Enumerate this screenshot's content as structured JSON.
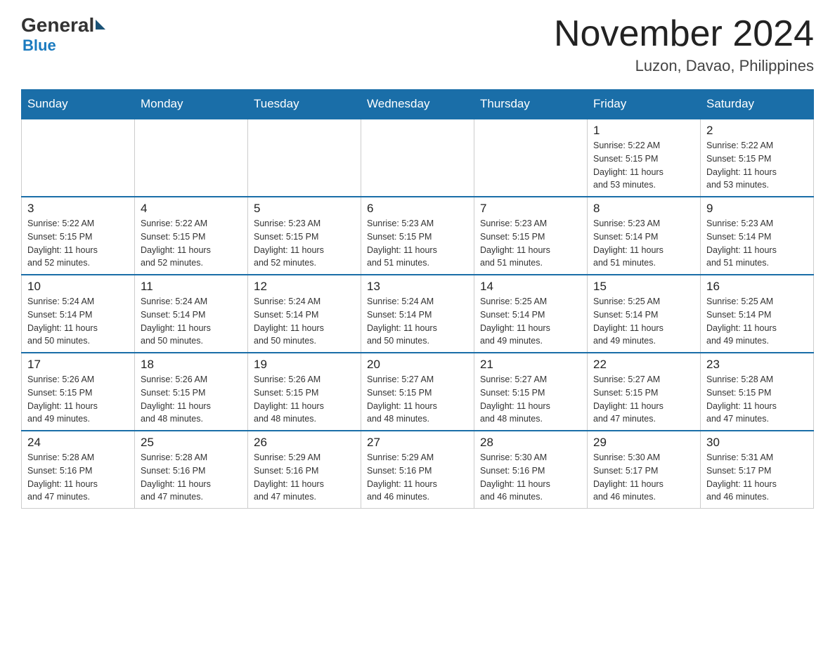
{
  "logo": {
    "general": "General",
    "blue": "Blue"
  },
  "header": {
    "month_year": "November 2024",
    "location": "Luzon, Davao, Philippines"
  },
  "weekdays": [
    "Sunday",
    "Monday",
    "Tuesday",
    "Wednesday",
    "Thursday",
    "Friday",
    "Saturday"
  ],
  "weeks": [
    [
      {
        "day": "",
        "info": ""
      },
      {
        "day": "",
        "info": ""
      },
      {
        "day": "",
        "info": ""
      },
      {
        "day": "",
        "info": ""
      },
      {
        "day": "",
        "info": ""
      },
      {
        "day": "1",
        "info": "Sunrise: 5:22 AM\nSunset: 5:15 PM\nDaylight: 11 hours\nand 53 minutes."
      },
      {
        "day": "2",
        "info": "Sunrise: 5:22 AM\nSunset: 5:15 PM\nDaylight: 11 hours\nand 53 minutes."
      }
    ],
    [
      {
        "day": "3",
        "info": "Sunrise: 5:22 AM\nSunset: 5:15 PM\nDaylight: 11 hours\nand 52 minutes."
      },
      {
        "day": "4",
        "info": "Sunrise: 5:22 AM\nSunset: 5:15 PM\nDaylight: 11 hours\nand 52 minutes."
      },
      {
        "day": "5",
        "info": "Sunrise: 5:23 AM\nSunset: 5:15 PM\nDaylight: 11 hours\nand 52 minutes."
      },
      {
        "day": "6",
        "info": "Sunrise: 5:23 AM\nSunset: 5:15 PM\nDaylight: 11 hours\nand 51 minutes."
      },
      {
        "day": "7",
        "info": "Sunrise: 5:23 AM\nSunset: 5:15 PM\nDaylight: 11 hours\nand 51 minutes."
      },
      {
        "day": "8",
        "info": "Sunrise: 5:23 AM\nSunset: 5:14 PM\nDaylight: 11 hours\nand 51 minutes."
      },
      {
        "day": "9",
        "info": "Sunrise: 5:23 AM\nSunset: 5:14 PM\nDaylight: 11 hours\nand 51 minutes."
      }
    ],
    [
      {
        "day": "10",
        "info": "Sunrise: 5:24 AM\nSunset: 5:14 PM\nDaylight: 11 hours\nand 50 minutes."
      },
      {
        "day": "11",
        "info": "Sunrise: 5:24 AM\nSunset: 5:14 PM\nDaylight: 11 hours\nand 50 minutes."
      },
      {
        "day": "12",
        "info": "Sunrise: 5:24 AM\nSunset: 5:14 PM\nDaylight: 11 hours\nand 50 minutes."
      },
      {
        "day": "13",
        "info": "Sunrise: 5:24 AM\nSunset: 5:14 PM\nDaylight: 11 hours\nand 50 minutes."
      },
      {
        "day": "14",
        "info": "Sunrise: 5:25 AM\nSunset: 5:14 PM\nDaylight: 11 hours\nand 49 minutes."
      },
      {
        "day": "15",
        "info": "Sunrise: 5:25 AM\nSunset: 5:14 PM\nDaylight: 11 hours\nand 49 minutes."
      },
      {
        "day": "16",
        "info": "Sunrise: 5:25 AM\nSunset: 5:14 PM\nDaylight: 11 hours\nand 49 minutes."
      }
    ],
    [
      {
        "day": "17",
        "info": "Sunrise: 5:26 AM\nSunset: 5:15 PM\nDaylight: 11 hours\nand 49 minutes."
      },
      {
        "day": "18",
        "info": "Sunrise: 5:26 AM\nSunset: 5:15 PM\nDaylight: 11 hours\nand 48 minutes."
      },
      {
        "day": "19",
        "info": "Sunrise: 5:26 AM\nSunset: 5:15 PM\nDaylight: 11 hours\nand 48 minutes."
      },
      {
        "day": "20",
        "info": "Sunrise: 5:27 AM\nSunset: 5:15 PM\nDaylight: 11 hours\nand 48 minutes."
      },
      {
        "day": "21",
        "info": "Sunrise: 5:27 AM\nSunset: 5:15 PM\nDaylight: 11 hours\nand 48 minutes."
      },
      {
        "day": "22",
        "info": "Sunrise: 5:27 AM\nSunset: 5:15 PM\nDaylight: 11 hours\nand 47 minutes."
      },
      {
        "day": "23",
        "info": "Sunrise: 5:28 AM\nSunset: 5:15 PM\nDaylight: 11 hours\nand 47 minutes."
      }
    ],
    [
      {
        "day": "24",
        "info": "Sunrise: 5:28 AM\nSunset: 5:16 PM\nDaylight: 11 hours\nand 47 minutes."
      },
      {
        "day": "25",
        "info": "Sunrise: 5:28 AM\nSunset: 5:16 PM\nDaylight: 11 hours\nand 47 minutes."
      },
      {
        "day": "26",
        "info": "Sunrise: 5:29 AM\nSunset: 5:16 PM\nDaylight: 11 hours\nand 47 minutes."
      },
      {
        "day": "27",
        "info": "Sunrise: 5:29 AM\nSunset: 5:16 PM\nDaylight: 11 hours\nand 46 minutes."
      },
      {
        "day": "28",
        "info": "Sunrise: 5:30 AM\nSunset: 5:16 PM\nDaylight: 11 hours\nand 46 minutes."
      },
      {
        "day": "29",
        "info": "Sunrise: 5:30 AM\nSunset: 5:17 PM\nDaylight: 11 hours\nand 46 minutes."
      },
      {
        "day": "30",
        "info": "Sunrise: 5:31 AM\nSunset: 5:17 PM\nDaylight: 11 hours\nand 46 minutes."
      }
    ]
  ]
}
